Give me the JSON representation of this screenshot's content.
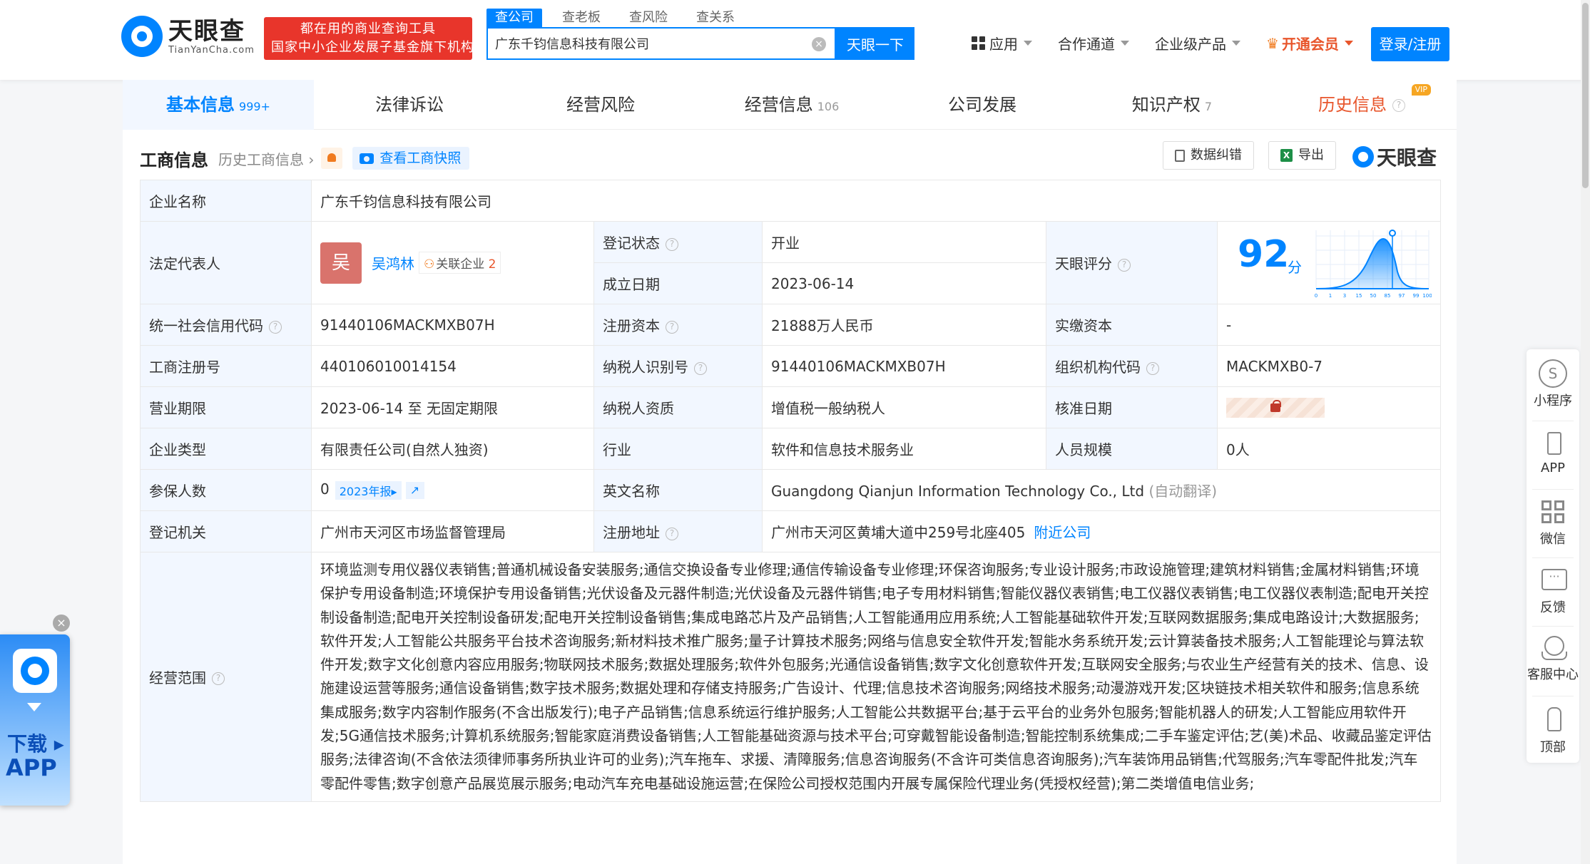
{
  "header": {
    "logo_cn": "天眼查",
    "logo_en": "TianYanCha.com",
    "slogan_line1": "都在用的商业查询工具",
    "slogan_line2": "国家中小企业发展子基金旗下机构",
    "search_tabs": [
      "查公司",
      "查老板",
      "查风险",
      "查关系"
    ],
    "search_value": "广东千钧信息科技有限公司",
    "search_button": "天眼一下",
    "nav": [
      "应用",
      "合作通道",
      "企业级产品"
    ],
    "vip_nav": "开通会员",
    "login": "登录/注册"
  },
  "tabs": [
    {
      "label": "基本信息",
      "count": "999+"
    },
    {
      "label": "法律诉讼",
      "count": ""
    },
    {
      "label": "经营风险",
      "count": ""
    },
    {
      "label": "经营信息",
      "count": "106"
    },
    {
      "label": "公司发展",
      "count": ""
    },
    {
      "label": "知识产权",
      "count": "7"
    },
    {
      "label": "历史信息",
      "count": "",
      "badge": "VIP"
    }
  ],
  "section": {
    "title": "工商信息",
    "history": "历史工商信息",
    "snapshot": "查看工商快照",
    "correct_btn": "数据纠错",
    "export_btn": "导出",
    "brand": "天眼查"
  },
  "info": {
    "company_name_label": "企业名称",
    "company_name": "广东千钧信息科技有限公司",
    "legal_rep_label": "法定代表人",
    "legal_rep_avatar": "吴",
    "legal_rep": "吴鸿林",
    "related_label": "关联企业",
    "related_count": "2",
    "reg_status_label": "登记状态",
    "reg_status": "开业",
    "found_date_label": "成立日期",
    "found_date": "2023-06-14",
    "score_label": "天眼评分",
    "score": "92",
    "score_unit": "分",
    "score_axis": [
      "0",
      "1",
      "3",
      "15",
      "50",
      "85",
      "97",
      "99",
      "100"
    ],
    "credit_code_label": "统一社会信用代码",
    "credit_code": "91440106MACKMXB07H",
    "reg_capital_label": "注册资本",
    "reg_capital": "21888万人民币",
    "paid_capital_label": "实缴资本",
    "paid_capital": "-",
    "reg_no_label": "工商注册号",
    "reg_no": "440106010014154",
    "taxpayer_id_label": "纳税人识别号",
    "taxpayer_id": "91440106MACKMXB07H",
    "org_code_label": "组织机构代码",
    "org_code": "MACKMXB0-7",
    "term_label": "营业期限",
    "term": "2023-06-14 至 无固定期限",
    "tax_qual_label": "纳税人资质",
    "tax_qual": "增值税一般纳税人",
    "approve_label": "核准日期",
    "type_label": "企业类型",
    "type": "有限责任公司(自然人独资)",
    "industry_label": "行业",
    "industry": "软件和信息技术服务业",
    "staff_label": "人员规模",
    "staff": "0人",
    "insured_label": "参保人数",
    "insured": "0",
    "insured_report": "2023年报",
    "english_label": "英文名称",
    "english": "Guangdong Qianjun Information Technology Co., Ltd",
    "auto_translate": "(自动翻译)",
    "authority_label": "登记机关",
    "authority": "广州市天河区市场监督管理局",
    "address_label": "注册地址",
    "address": "广州市天河区黄埔大道中259号北座405",
    "nearby": "附近公司",
    "scope_label": "经营范围",
    "scope": "环境监测专用仪器仪表销售;普通机械设备安装服务;通信交换设备专业修理;通信传输设备专业修理;环保咨询服务;专业设计服务;市政设施管理;建筑材料销售;金属材料销售;环境保护专用设备制造;环境保护专用设备销售;光伏设备及元器件制造;光伏设备及元器件销售;电子专用材料销售;智能仪器仪表销售;电工仪器仪表销售;电工仪器仪表制造;配电开关控制设备制造;配电开关控制设备研发;配电开关控制设备销售;集成电路芯片及产品销售;人工智能通用应用系统;人工智能基础软件开发;互联网数据服务;集成电路设计;大数据服务;软件开发;人工智能公共服务平台技术咨询服务;新材料技术推广服务;量子计算技术服务;网络与信息安全软件开发;智能水务系统开发;云计算装备技术服务;人工智能理论与算法软件开发;数字文化创意内容应用服务;物联网技术服务;数据处理服务;软件外包服务;光通信设备销售;数字文化创意软件开发;互联网安全服务;与农业生产经营有关的技术、信息、设施建设运营等服务;通信设备销售;数字技术服务;数据处理和存储支持服务;广告设计、代理;信息技术咨询服务;网络技术服务;动漫游戏开发;区块链技术相关软件和服务;信息系统集成服务;数字内容制作服务(不含出版发行);电子产品销售;信息系统运行维护服务;人工智能公共数据平台;基于云平台的业务外包服务;智能机器人的研发;人工智能应用软件开发;5G通信技术服务;计算机系统服务;智能家庭消费设备销售;人工智能基础资源与技术平台;可穿戴智能设备制造;智能控制系统集成;二手车鉴定评估;艺(美)术品、收藏品鉴定评估服务;法律咨询(不含依法须律师事务所执业许可的业务);汽车拖车、求援、清障服务;信息咨询服务(不含许可类信息咨询服务);汽车装饰用品销售;代驾服务;汽车零配件批发;汽车零配件零售;数字创意产品展览展示服务;电动汽车充电基础设施运营;在保险公司授权范围内开展专属保险代理业务(凭授权经营);第二类增值电信业务;"
  },
  "side": [
    "小程序",
    "APP",
    "微信",
    "反馈",
    "客服中心",
    "顶部"
  ],
  "download": {
    "line1": "下载",
    "line2": "APP"
  }
}
